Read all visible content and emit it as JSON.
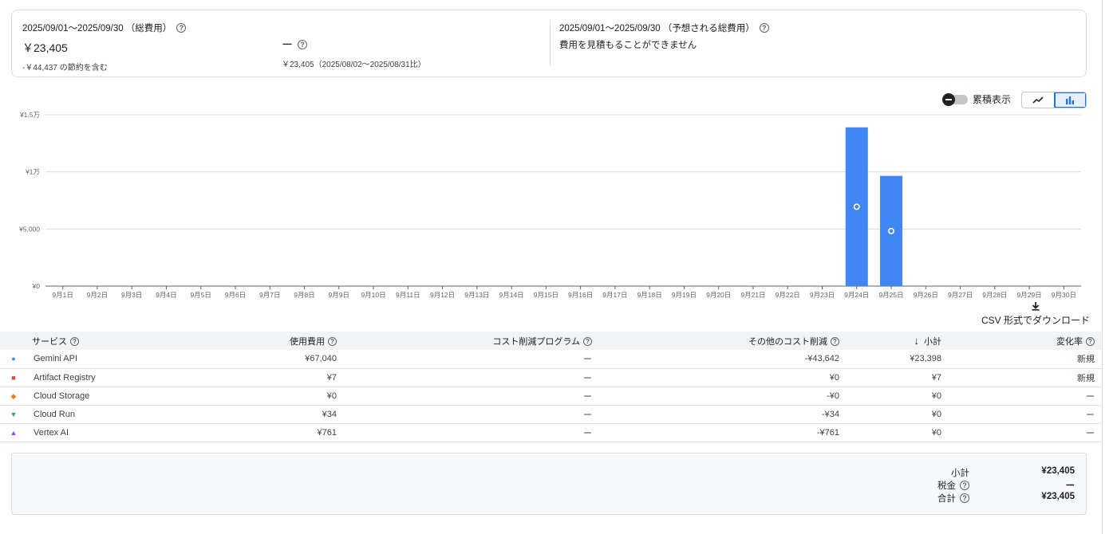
{
  "summary": {
    "left_title": "2025/09/01〜2025/09/30 （総費用）",
    "left_value": "￥23,405",
    "left_sub": "-￥44,437 の節約を含む",
    "mid_value": "ー",
    "mid_sub": "￥23,405（2025/08/02〜2025/08/31比）",
    "right_title": "2025/09/01〜2025/09/30 （予想される総費用）",
    "right_sub": "費用を見積もることができません"
  },
  "controls": {
    "cumulative_label": "累積表示",
    "cumulative_on": false,
    "chart_mode": "bar",
    "csv_label": "CSV 形式でダウンロード"
  },
  "chart_data": {
    "type": "bar",
    "categories": [
      "9月1日",
      "9月2日",
      "9月3日",
      "9月4日",
      "9月5日",
      "9月6日",
      "9月7日",
      "9月8日",
      "9月9日",
      "9月10日",
      "9月11日",
      "9月12日",
      "9月13日",
      "9月14日",
      "9月15日",
      "9月16日",
      "9月17日",
      "9月18日",
      "9月19日",
      "9月20日",
      "9月21日",
      "9月22日",
      "9月23日",
      "9月24日",
      "9月25日",
      "9月26日",
      "9月27日",
      "9月28日",
      "9月29日",
      "9月30日"
    ],
    "values": [
      0,
      0,
      0,
      0,
      0,
      0,
      0,
      0,
      0,
      0,
      0,
      0,
      0,
      0,
      0,
      0,
      0,
      0,
      0,
      0,
      0,
      0,
      0,
      13900,
      9650,
      0,
      0,
      0,
      0,
      0
    ],
    "ylim": [
      0,
      15000
    ],
    "yticks": [
      0,
      5000,
      10000,
      15000
    ],
    "ytick_labels": [
      "¥0",
      "¥5,000",
      "¥1万",
      "¥1.5万"
    ],
    "grid": true,
    "bar_color": "#4285f4"
  },
  "table": {
    "headers": {
      "service": "サービス",
      "usage": "使用費用",
      "program": "コスト削減プログラム",
      "other": "その他のコスト削減",
      "subtotal": "小計",
      "change": "変化率"
    },
    "rows": [
      {
        "marker": "●",
        "color": "#4285f4",
        "service": "Gemini API",
        "usage": "¥67,040",
        "program": "ー",
        "other": "-¥43,642",
        "subtotal": "¥23,398",
        "change": "新規"
      },
      {
        "marker": "■",
        "color": "#ea4335",
        "service": "Artifact Registry",
        "usage": "¥7",
        "program": "ー",
        "other": "¥0",
        "subtotal": "¥7",
        "change": "新規"
      },
      {
        "marker": "◆",
        "color": "#fa7b17",
        "service": "Cloud Storage",
        "usage": "¥0",
        "program": "ー",
        "other": "-¥0",
        "subtotal": "¥0",
        "change": "ー"
      },
      {
        "marker": "▼",
        "color": "#34a853",
        "service": "Cloud Run",
        "usage": "¥34",
        "program": "ー",
        "other": "-¥34",
        "subtotal": "¥0",
        "change": "ー"
      },
      {
        "marker": "▲",
        "color": "#a142f4",
        "service": "Vertex AI",
        "usage": "¥761",
        "program": "ー",
        "other": "-¥761",
        "subtotal": "¥0",
        "change": "ー"
      }
    ]
  },
  "totals": {
    "subtotal_label": "小計",
    "subtotal_value": "¥23,405",
    "tax_label": "税金",
    "tax_value": "ー",
    "total_label": "合計",
    "total_value": "¥23,405"
  }
}
